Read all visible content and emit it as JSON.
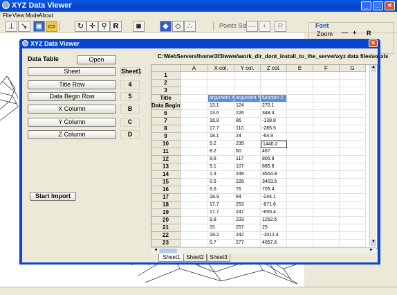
{
  "app": {
    "title": "XYZ Data Viewer",
    "menus": [
      "File",
      "View",
      "Mode",
      "About"
    ],
    "points_size_label": "Points Size",
    "minus_label": "—",
    "plus_label": "+",
    "r_label": "R",
    "right_panel": {
      "font_label": "Font",
      "zoom_label": "Zoom",
      "zoom_minus": "—",
      "zoom_plus": "+",
      "r": "R"
    }
  },
  "dialog": {
    "title": "XYZ Data Viewer",
    "path": "C:\\WebServers\\home\\3f3\\www\\work_dir_dont_install_to_the_server\\xyz data files\\ex.xls",
    "data_table_label": "Data Table",
    "open_label": "Open",
    "fields": [
      {
        "label": "Sheet",
        "value": "Sheet1"
      },
      {
        "label": "Title Row",
        "value": "4"
      },
      {
        "label": "Data Begin Row",
        "value": "5"
      },
      {
        "label": "X Column",
        "value": "B"
      },
      {
        "label": "Y Column",
        "value": "C"
      },
      {
        "label": "Z Column",
        "value": "D"
      }
    ],
    "start_import_label": "Start Import"
  },
  "sheet": {
    "corner": "",
    "columns": [
      "A",
      "X col.",
      "Y col.",
      "Z col.",
      "E",
      "F",
      "G"
    ],
    "rows": [
      {
        "h": "1",
        "c": [
          "",
          "",
          "",
          "",
          "",
          "",
          ""
        ]
      },
      {
        "h": "2",
        "c": [
          "",
          "",
          "",
          "",
          "",
          "",
          ""
        ]
      },
      {
        "h": "3",
        "c": [
          "",
          "",
          "",
          "",
          "",
          "",
          ""
        ]
      },
      {
        "h": "Title",
        "c": [
          "",
          "argument X",
          "argument Y",
          "function Z",
          "",
          "",
          ""
        ]
      },
      {
        "h": "Data Begin",
        "c": [
          "",
          "13.1",
          "124",
          "270.1",
          "",
          "",
          ""
        ]
      },
      {
        "h": "6",
        "c": [
          "",
          "13.6",
          "226",
          "348.4",
          "",
          "",
          ""
        ]
      },
      {
        "h": "7",
        "c": [
          "",
          "16.8",
          "86",
          "-138.8",
          "",
          "",
          ""
        ]
      },
      {
        "h": "8",
        "c": [
          "",
          "17.7",
          "110",
          "-285.5",
          "",
          "",
          ""
        ]
      },
      {
        "h": "9",
        "c": [
          "",
          "18.1",
          "24",
          "-64.9",
          "",
          "",
          ""
        ]
      },
      {
        "h": "10",
        "c": [
          "",
          "9.2",
          "239",
          "1440.2",
          "",
          "",
          ""
        ]
      },
      {
        "h": "11",
        "c": [
          "",
          "8.2",
          "60",
          "467",
          "",
          "",
          ""
        ]
      },
      {
        "h": "12",
        "c": [
          "",
          "8.6",
          "117",
          "805.8",
          "",
          "",
          ""
        ]
      },
      {
        "h": "13",
        "c": [
          "",
          "9.1",
          "107",
          "685.8",
          "",
          "",
          ""
        ]
      },
      {
        "h": "14",
        "c": [
          "",
          "1.3",
          "249",
          "3504.8",
          "",
          "",
          ""
        ]
      },
      {
        "h": "15",
        "c": [
          "",
          "0.5",
          "228",
          "3403.5",
          "",
          "",
          ""
        ]
      },
      {
        "h": "16",
        "c": [
          "",
          "6.6",
          "76",
          "705.4",
          "",
          "",
          ""
        ]
      },
      {
        "h": "17",
        "c": [
          "",
          "18.9",
          "64",
          "-244.1",
          "",
          "",
          ""
        ]
      },
      {
        "h": "18",
        "c": [
          "",
          "17.7",
          "253",
          "-671.6",
          "",
          "",
          ""
        ]
      },
      {
        "h": "19",
        "c": [
          "",
          "17.7",
          "247",
          "-655.4",
          "",
          "",
          ""
        ]
      },
      {
        "h": "20",
        "c": [
          "",
          "9.8",
          "233",
          "1262.6",
          "",
          "",
          ""
        ]
      },
      {
        "h": "21",
        "c": [
          "",
          "15",
          "257",
          "25",
          "",
          "",
          ""
        ]
      },
      {
        "h": "22",
        "c": [
          "",
          "19.2",
          "242",
          "-1012.4",
          "",
          "",
          ""
        ]
      },
      {
        "h": "23",
        "c": [
          "",
          "0.7",
          "277",
          "4057.6",
          "",
          "",
          ""
        ]
      }
    ],
    "tabs": [
      "Sheet1",
      "Sheet2",
      "Sheet3"
    ]
  }
}
